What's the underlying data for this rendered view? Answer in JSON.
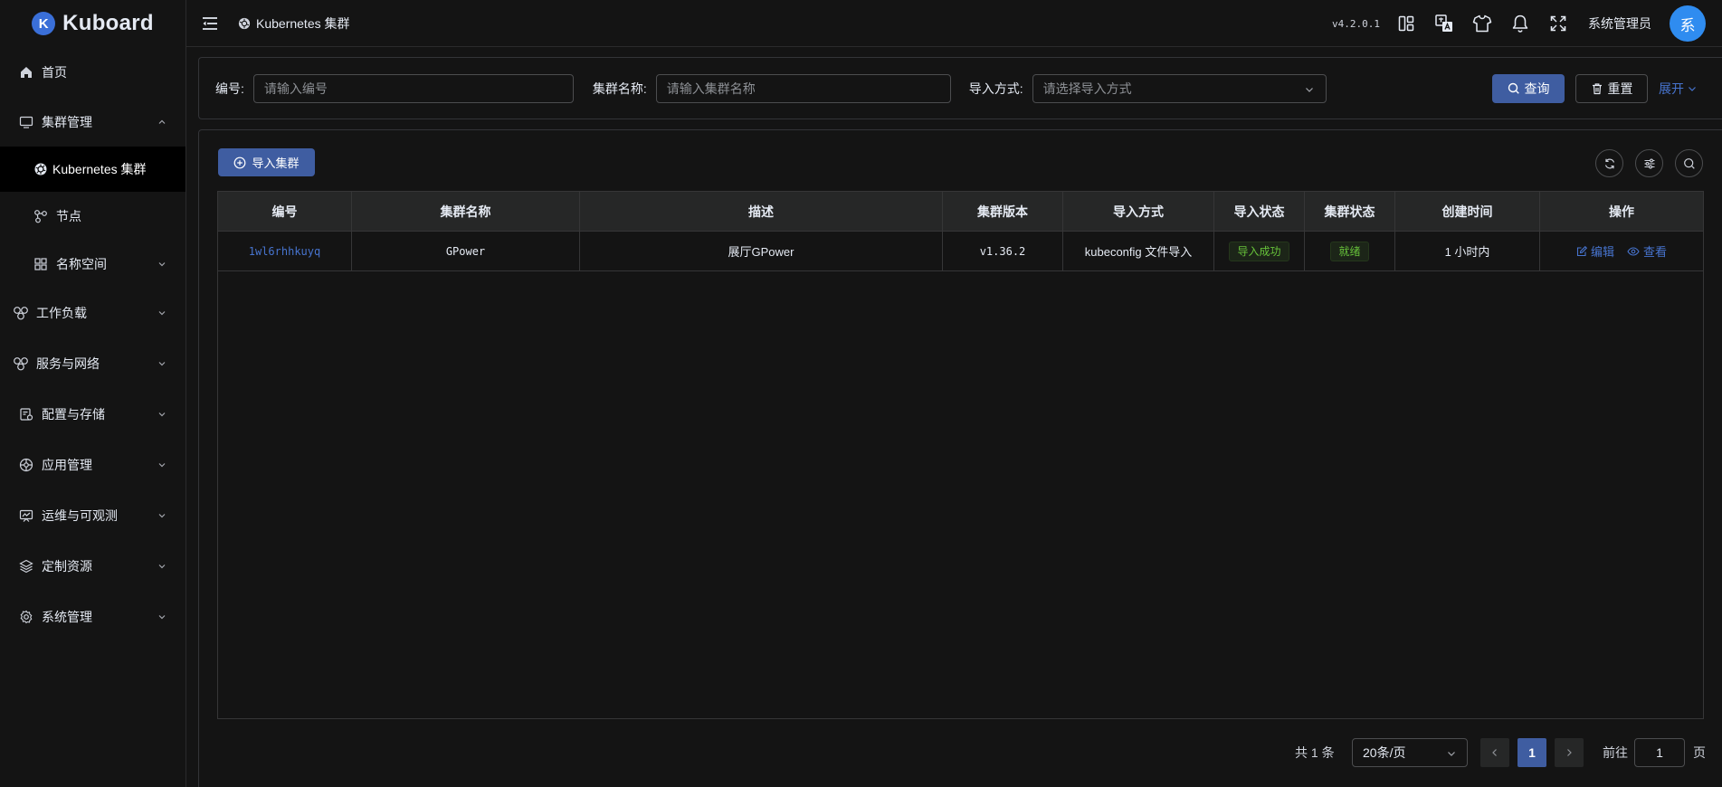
{
  "app": {
    "logo_letter": "K",
    "name": "Kuboard"
  },
  "sidebar": {
    "items": [
      {
        "label": "首页",
        "icon": "home-icon"
      },
      {
        "label": "集群管理",
        "icon": "monitor-icon",
        "expanded": true
      },
      {
        "label": "Kubernetes 集群",
        "icon": "kubernetes-icon",
        "active": true
      },
      {
        "label": "节点",
        "icon": "nodes-icon"
      },
      {
        "label": "名称空间",
        "icon": "grid-icon"
      },
      {
        "label": "工作负载",
        "icon": "workload-icon"
      },
      {
        "label": "服务与网络",
        "icon": "network-icon"
      },
      {
        "label": "配置与存储",
        "icon": "storage-icon"
      },
      {
        "label": "应用管理",
        "icon": "app-icon"
      },
      {
        "label": "运维与可观测",
        "icon": "observe-icon"
      },
      {
        "label": "定制资源",
        "icon": "layers-icon"
      },
      {
        "label": "系统管理",
        "icon": "gear-icon"
      }
    ]
  },
  "header": {
    "breadcrumb": "Kubernetes 集群",
    "version": "v4.2.0.1",
    "user_name": "系统管理员",
    "avatar_text": "系"
  },
  "filter": {
    "id_label": "编号:",
    "id_placeholder": "请输入编号",
    "name_label": "集群名称:",
    "name_placeholder": "请输入集群名称",
    "method_label": "导入方式:",
    "method_placeholder": "请选择导入方式",
    "query_label": "查询",
    "reset_label": "重置",
    "expand_label": "展开"
  },
  "toolbar": {
    "import_label": "导入集群"
  },
  "table": {
    "columns": [
      "编号",
      "集群名称",
      "描述",
      "集群版本",
      "导入方式",
      "导入状态",
      "集群状态",
      "创建时间",
      "操作"
    ],
    "rows": [
      {
        "id": "1wl6rhhkuyq",
        "name": "GPower",
        "description": "展厅GPower",
        "version": "v1.36.2",
        "method": "kubeconfig 文件导入",
        "import_status": "导入成功",
        "cluster_status": "就绪",
        "created": "1 小时内",
        "edit": "编辑",
        "view": "查看"
      }
    ]
  },
  "pagination": {
    "total": "共 1 条",
    "page_size": "20条/页",
    "current_page": "1",
    "goto_label": "前往",
    "goto_value": "1",
    "page_suffix": "页"
  },
  "colors": {
    "accent": "#3f5da1",
    "link": "#4774cf",
    "success": "#67c23a",
    "avatar": "#2f8cf0"
  }
}
